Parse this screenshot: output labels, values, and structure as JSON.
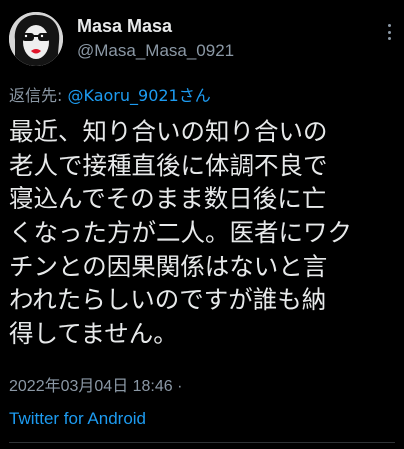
{
  "user": {
    "display_name": "Masa Masa",
    "handle": "@Masa_Masa_0921"
  },
  "reply": {
    "prefix": "返信先: ",
    "mention": "@Kaoru_9021さん"
  },
  "tweet": {
    "lines": [
      "最近、知り合いの知り合いの",
      "老人で接種直後に体調不良で",
      "寝込んでそのまま数日後に亡",
      "くなった方が二人。医者にワク",
      "チンとの因果関係はないと言",
      "われたらしいのですが誰も納",
      "得してません。"
    ],
    "timestamp": "2022年03月04日 18:46 ·",
    "source": "Twitter for Android"
  },
  "icons": {
    "more": "more-vertical-icon",
    "avatar": "avatar-image"
  },
  "colors": {
    "background": "#000000",
    "text": "#e7e9ea",
    "secondary": "#8b98a5",
    "link": "#1d9bf0"
  }
}
